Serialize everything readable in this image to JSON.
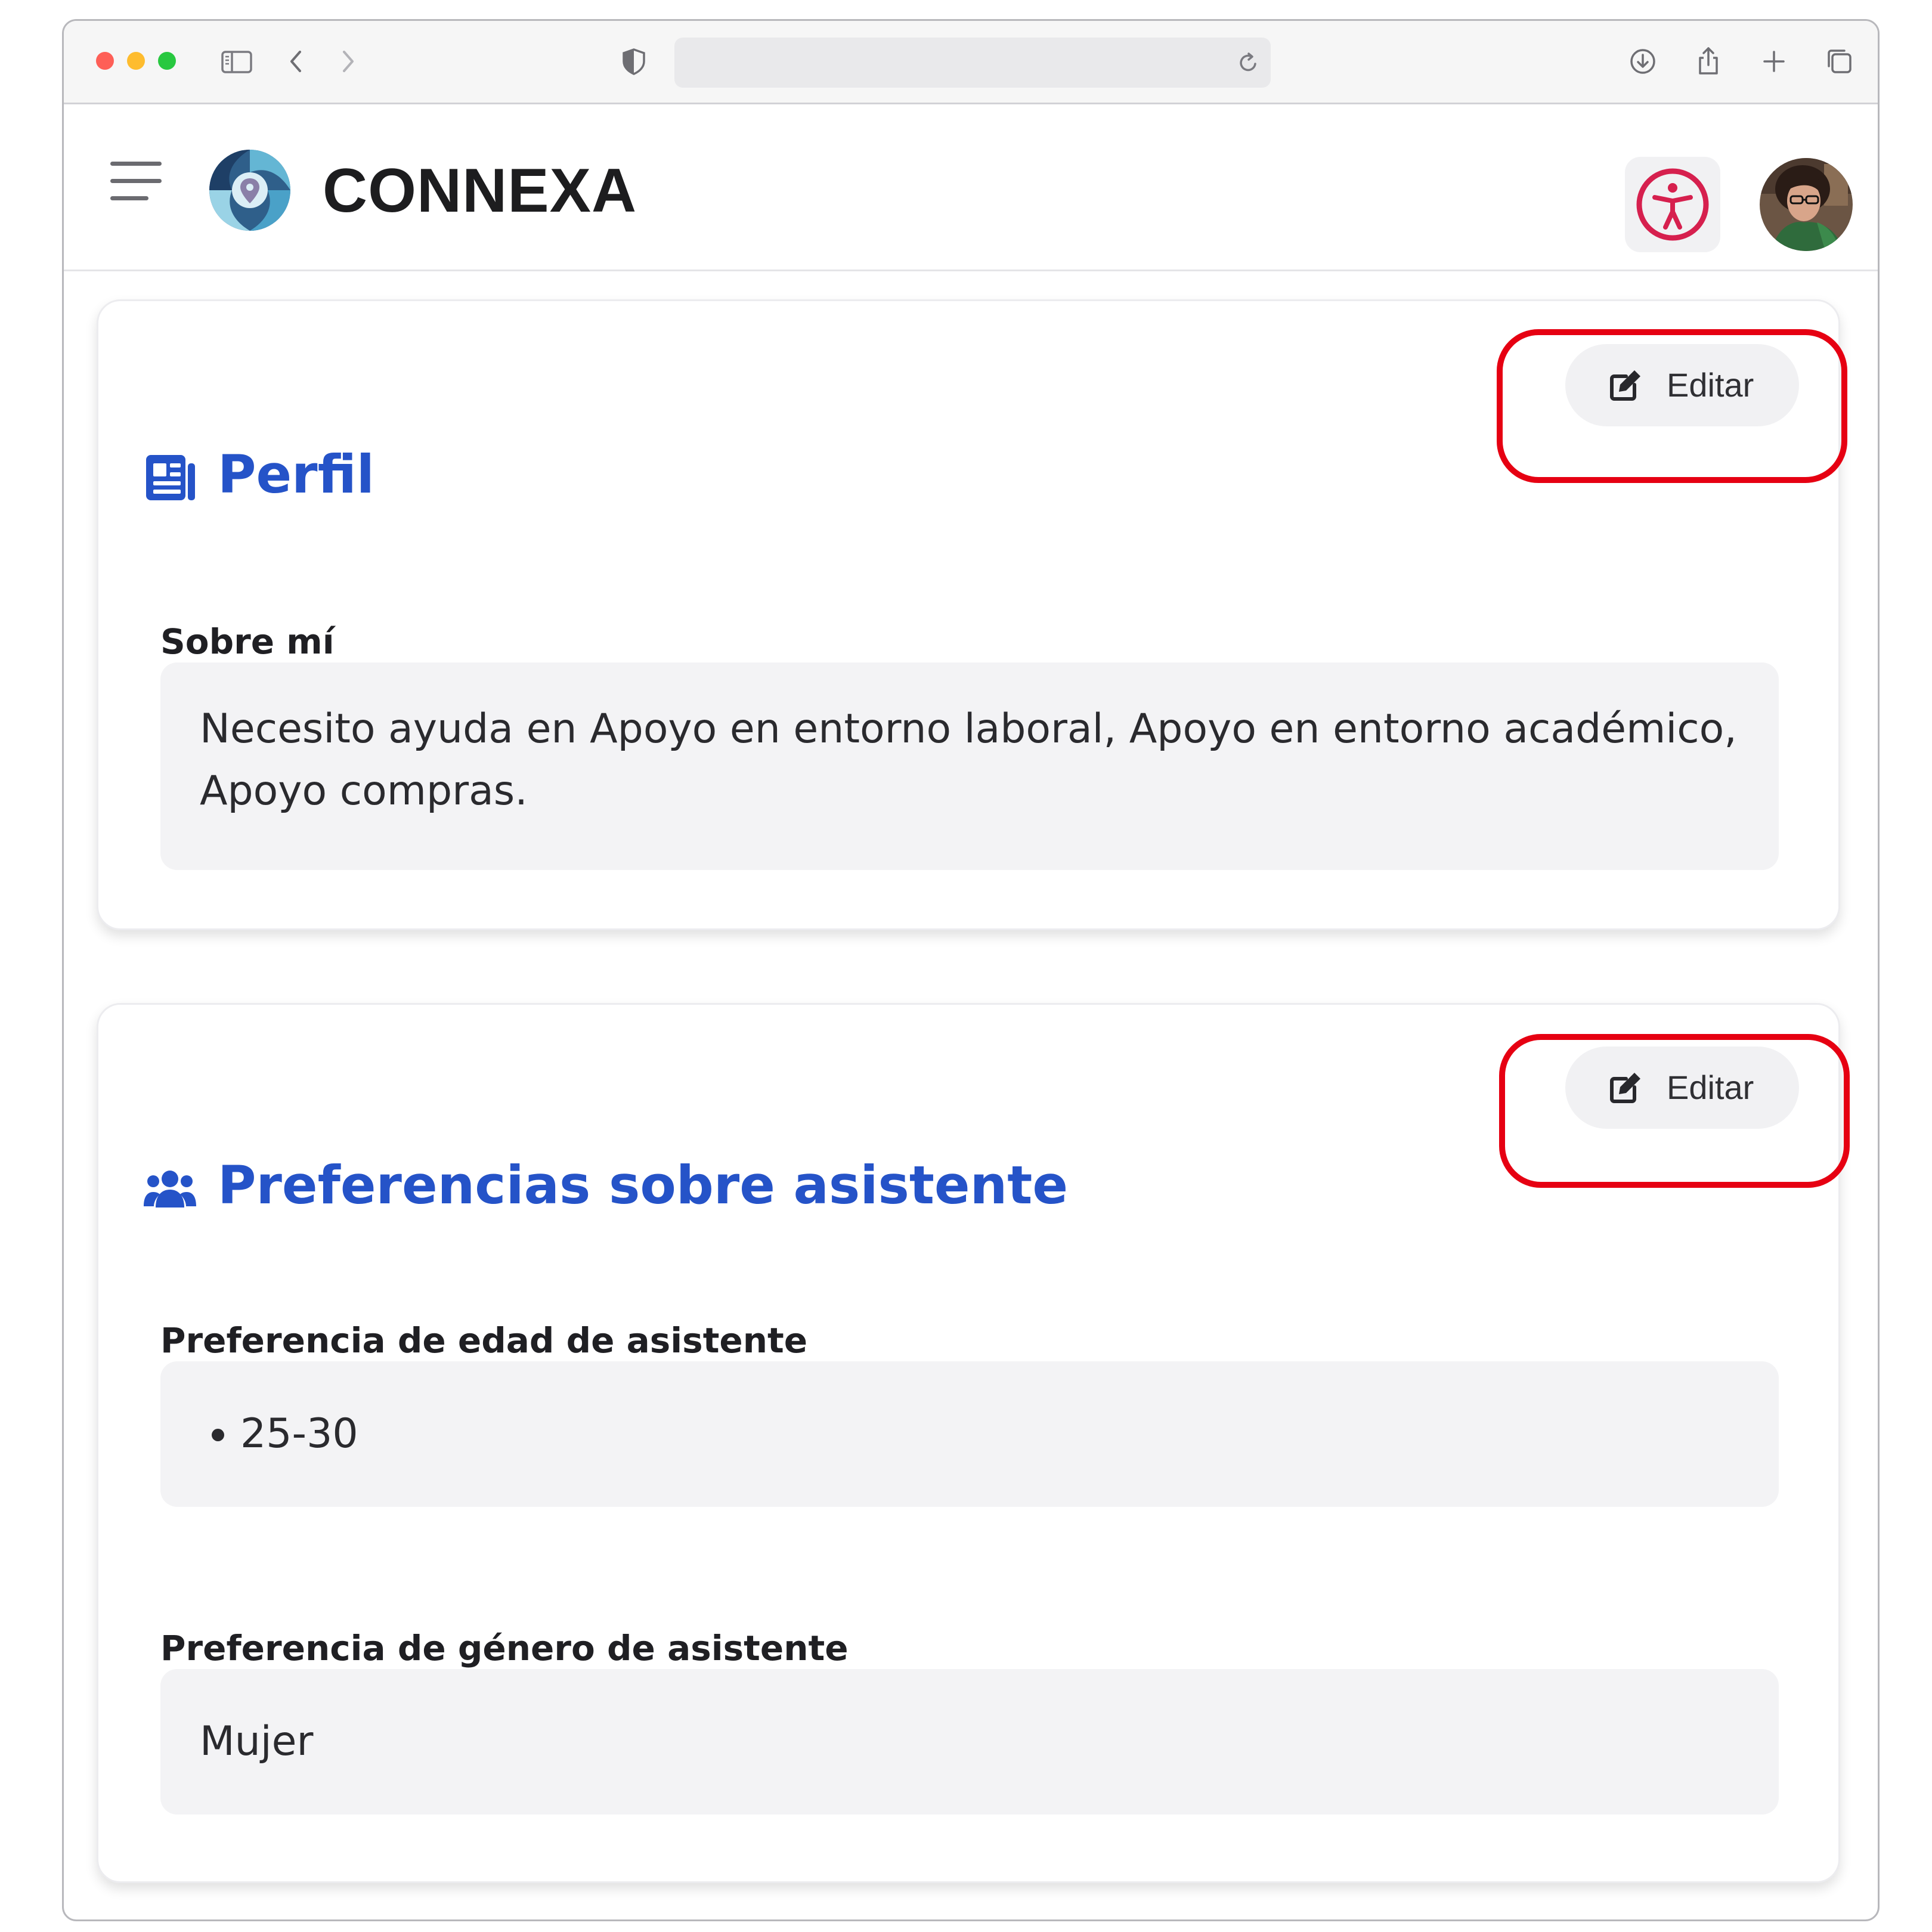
{
  "browser": {
    "url": ""
  },
  "header": {
    "brand": "CONNEXA"
  },
  "perfil_card": {
    "title": "Perfil",
    "edit_label": "Editar",
    "about_label": "Sobre mí",
    "about_text": "Necesito ayuda en Apoyo en entorno laboral, Apoyo en entorno académico, Apoyo compras."
  },
  "preferencias_card": {
    "title": "Preferencias sobre asistente",
    "edit_label": "Editar",
    "age_label": "Preferencia de edad de asistente",
    "age_values": [
      "25-30"
    ],
    "gender_label": "Preferencia de género de asistente",
    "gender_value": "Mujer"
  },
  "colors": {
    "accent": "#2553c8",
    "highlight": "#e60012",
    "accessibility": "#d6204e"
  },
  "icons": {
    "menu": "hamburger-icon",
    "accessibility": "accessibility-icon",
    "edit": "edit-icon",
    "perfil": "newspaper-icon",
    "preferencias": "users-icon"
  }
}
